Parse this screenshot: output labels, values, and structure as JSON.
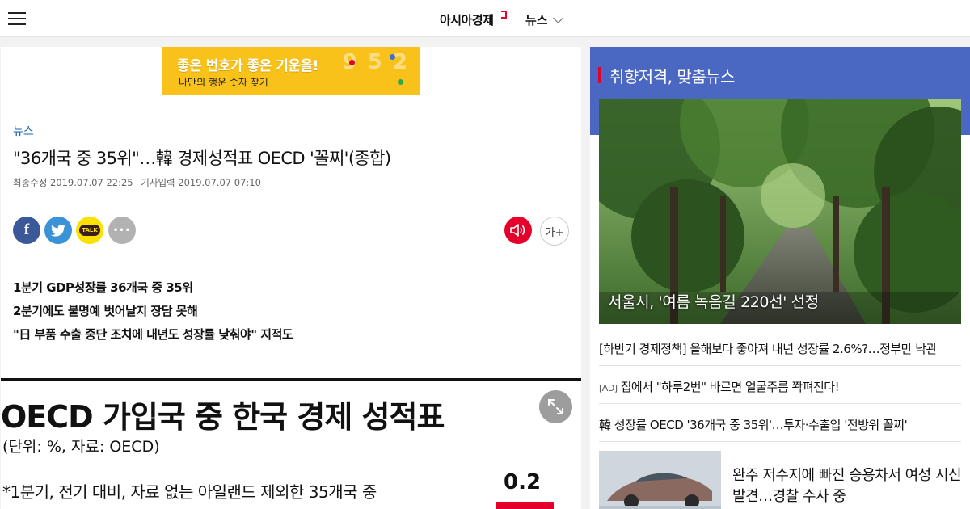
{
  "header": {
    "site_name": "아시아경제",
    "section": "뉴스"
  },
  "banner": {
    "title": "좋은 번호가 좋은 기운을!",
    "subtitle": "나만의 행운 숫자 찾기"
  },
  "article": {
    "category": "뉴스",
    "headline": "\"36개국 중 35위\"…韓 경제성적표 OECD '꼴찌'(종합)",
    "updated": "최종수정 2019.07.07 22:25",
    "published": "기사입력 2019.07.07 07:10",
    "share": {
      "facebook": "f",
      "kakao": "TALK",
      "more": "•••"
    },
    "font_size_button": "가+",
    "summary": [
      "1분기 GDP성장률 36개국 중 35위",
      "2분기에도 불명예 벗어날지 장담 못해",
      "\"日 부품 수출 중단 조치에 내년도 성장률 낮춰야\" 지적도"
    ],
    "figure": {
      "title": "OECD 가입국 중 한국 경제 성적표",
      "unit": "(단위: %, 자료: OECD)",
      "note": "*1분기, 전기 대비, 자료 없는 아일랜드 제외한 35개국 중",
      "value": "0.2"
    }
  },
  "sidebar": {
    "title": "취향저격, 맞춤뉴스",
    "feature_caption": "서울시, '여름 녹음길 220선' 선정",
    "links": [
      {
        "text": "[하반기 경제정책] 올해보다 좋아져 내년 성장률 2.6%?…정부만 낙관"
      },
      {
        "ad": "[AD]",
        "text": "집에서 \"하루2번\" 바르면 얼굴주름 쫙펴진다!"
      },
      {
        "text": "韓 성장률 OECD '36개국 중 35위'…투자·수출입 '전방위 꼴찌'"
      }
    ],
    "thumb_news": "완주 저수지에 빠진 승용차서 여성 시신 발견…경찰 수사 중"
  },
  "colors": {
    "accent_red": "#e4002b",
    "sidebar_blue": "#4a68c2",
    "banner_yellow": "#f9c21a",
    "facebook": "#3b5998",
    "twitter": "#3a93d6",
    "kakao": "#fae100"
  },
  "icons": [
    "menu-icon",
    "chevron-down-icon",
    "facebook-icon",
    "twitter-icon",
    "kakaotalk-icon",
    "more-icon",
    "speaker-icon",
    "expand-icon"
  ]
}
